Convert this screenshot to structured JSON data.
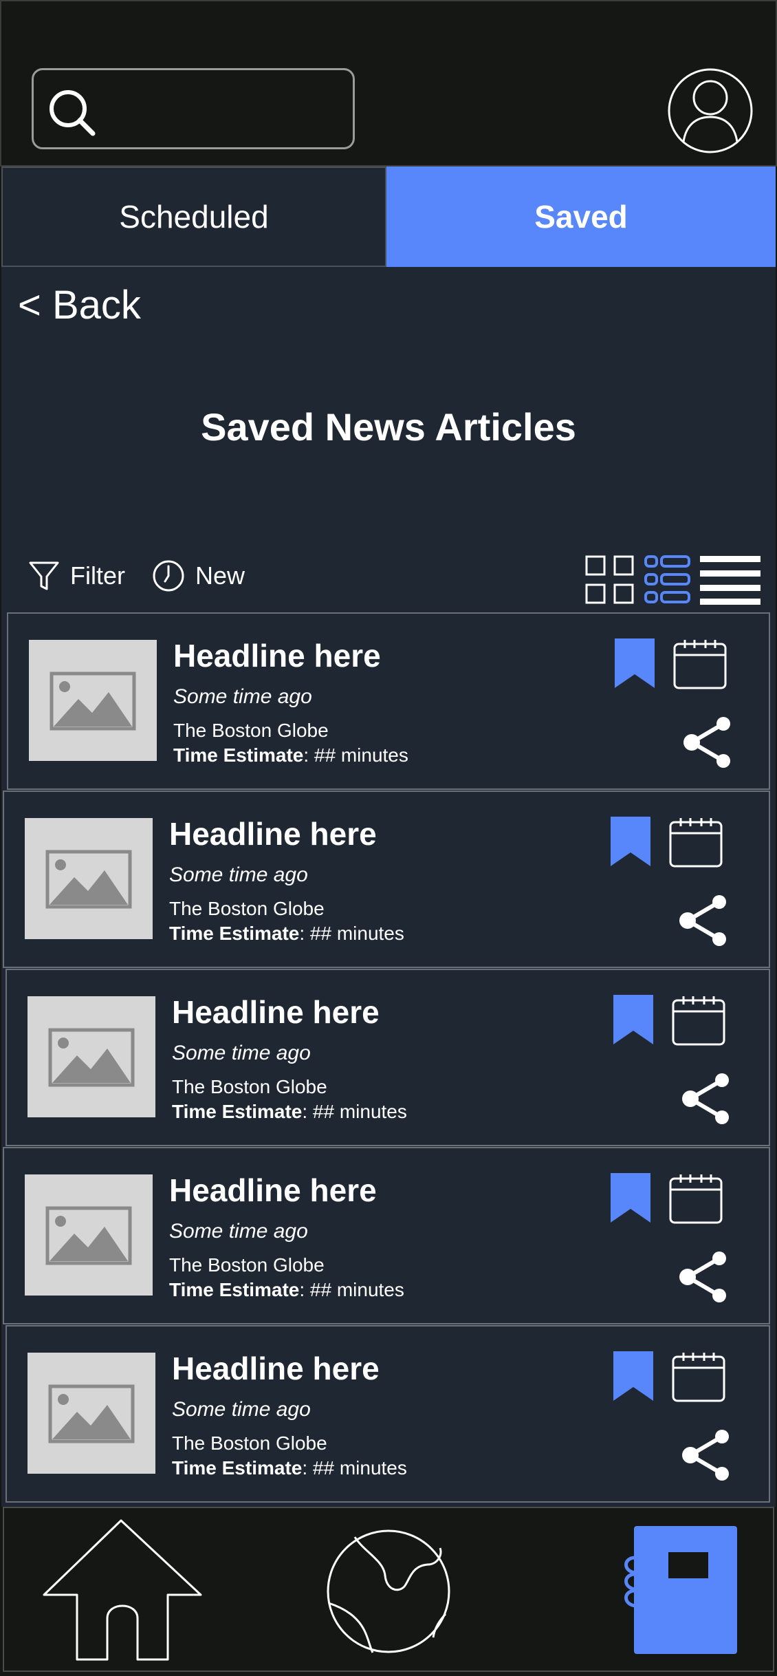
{
  "search": {
    "placeholder": ""
  },
  "tabs": [
    {
      "label": "Scheduled"
    },
    {
      "label": "Saved"
    }
  ],
  "back_label": "< Back",
  "page_title": "Saved News Articles",
  "toolbar": {
    "filter_label": "Filter",
    "new_label": "New"
  },
  "articles": [
    {
      "headline": "Headline here",
      "time": "Some time ago",
      "source": "The Boston Globe",
      "estimate_label": "Time Estimate",
      "estimate_value": ": ## minutes"
    },
    {
      "headline": "Headline here",
      "time": "Some time ago",
      "source": "The Boston Globe",
      "estimate_label": "Time Estimate",
      "estimate_value": ": ## minutes"
    },
    {
      "headline": "Headline here",
      "time": "Some time ago",
      "source": "The Boston Globe",
      "estimate_label": "Time Estimate",
      "estimate_value": ": ## minutes"
    },
    {
      "headline": "Headline here",
      "time": "Some time ago",
      "source": "The Boston Globe",
      "estimate_label": "Time Estimate",
      "estimate_value": ": ## minutes"
    },
    {
      "headline": "Headline here",
      "time": "Some time ago",
      "source": "The Boston Globe",
      "estimate_label": "Time Estimate",
      "estimate_value": ": ## minutes"
    }
  ],
  "icons": {
    "search": "search-icon",
    "avatar": "user-avatar-icon",
    "filter": "filter-icon",
    "new": "clock-icon",
    "grid_view": "grid-view-icon",
    "list_view": "list-view-icon",
    "compact_view": "compact-list-icon",
    "bookmark": "bookmark-icon",
    "calendar": "calendar-icon",
    "share": "share-icon",
    "home": "home-icon",
    "globe": "globe-icon",
    "notebook": "notebook-icon"
  },
  "colors": {
    "accent": "#5886fb",
    "panel": "#1f2732",
    "background": "#141713",
    "thumbnail": "#d6d6d6"
  }
}
